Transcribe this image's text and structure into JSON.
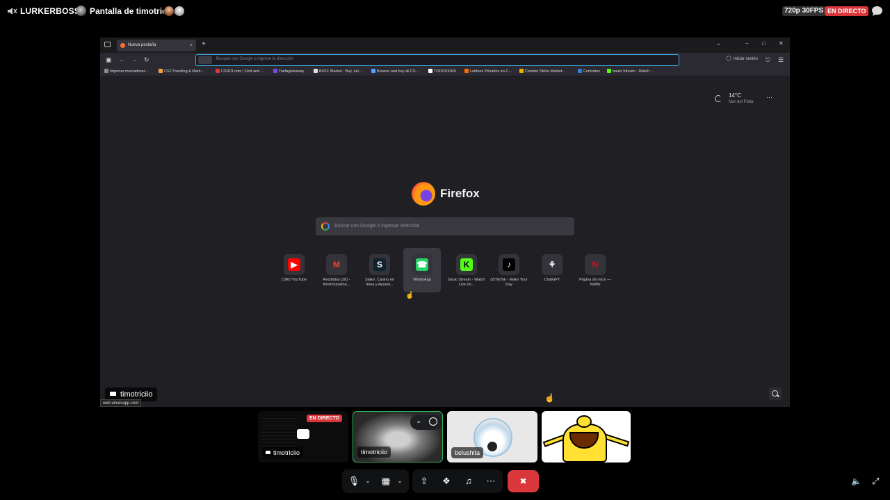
{
  "topbar": {
    "server_name": "LURKERBOSS",
    "separator": "·",
    "stream_title": "Pantalla de timotriciio",
    "quality": "720p 30FPS",
    "live_badge": "EN DIRECTO"
  },
  "browser": {
    "tab_title": "Nueva pestaña",
    "tab_close": "×",
    "new_tab": "+",
    "window_controls": {
      "list": "⌄",
      "minimize": "–",
      "restore": "□",
      "close": "✕"
    },
    "url_placeholder": "Busque con Google o ingrese la dirección",
    "signin_label": "Iniciar sesión",
    "bookmarks": [
      {
        "label": "Importar marcadores...",
        "color": "#8a8a8a"
      },
      {
        "label": "CS2 Trending & Mark...",
        "color": "#f2a33a"
      },
      {
        "label": "CSROI.com | Find and ...",
        "color": "#d83a3a"
      },
      {
        "label": "Tanfagiveaway",
        "color": "#7a4cdb"
      },
      {
        "label": "BUFF Market - Buy, sel...",
        "color": "#e0e0e0"
      },
      {
        "label": "Browse and buy all CS...",
        "color": "#4aa3ff"
      },
      {
        "label": "TODOSKINS",
        "color": "#ffffff"
      },
      {
        "label": "Lobbies Privados en C...",
        "color": "#ff6a00"
      },
      {
        "label": "Counter Strike Market...",
        "color": "#e8b100"
      },
      {
        "label": "Contratos",
        "color": "#3a7bd5"
      },
      {
        "label": "baulo Stream - Watch ...",
        "color": "#53fc18"
      }
    ],
    "weather": {
      "temp": "14°C",
      "city": "Mar del Plata"
    },
    "brand": "Firefox",
    "search_placeholder": "Buscar con Google o ingresar dirección",
    "shortcuts": [
      {
        "label": "(186) YouTube",
        "glyph": "▶",
        "bg": "#ff0000",
        "fg": "#ffffff"
      },
      {
        "label": "Recibidos (28) - timotricioalma...",
        "glyph": "M",
        "bg": "#34333a",
        "fg": "#ea4335"
      },
      {
        "label": "Stake: Casino en línea y Apuest...",
        "glyph": "S",
        "bg": "#0f212e",
        "fg": "#ffffff"
      },
      {
        "label": "WhatsApp",
        "glyph": "☎",
        "bg": "#25d366",
        "fg": "#ffffff"
      },
      {
        "label": "baulo Stream - Watch Live on...",
        "glyph": "K",
        "bg": "#53fc18",
        "fg": "#000000"
      },
      {
        "label": "(2)TikTok - Make Your Day",
        "glyph": "♪",
        "bg": "#000000",
        "fg": "#ffffff"
      },
      {
        "label": "ChatGPT",
        "glyph": "⚘",
        "bg": "#34333a",
        "fg": "#ffffff"
      },
      {
        "label": "Página de inicio — Netflix",
        "glyph": "N",
        "bg": "#34333a",
        "fg": "#e50914"
      }
    ],
    "status_url": "web.whatsapp.com"
  },
  "stream_overlay_name": "timotriciio",
  "participants": [
    {
      "name": "timotriciio",
      "live": "EN DIRECTO"
    },
    {
      "name": "timotriciio"
    },
    {
      "name": "belushita"
    },
    {
      "name": ""
    }
  ],
  "controls": {
    "mic_icon": "🎙",
    "chevron": "⌄",
    "camera_icon": "▦",
    "share_icon": "⇧",
    "activity_icon": "❖",
    "soundboard_icon": "♫",
    "more_icon": "⋯",
    "hangup_icon": "✖"
  },
  "colors": {
    "accent_live": "#da373c",
    "speaking_border": "#2fb45a",
    "url_focus": "#3aa6d8"
  }
}
